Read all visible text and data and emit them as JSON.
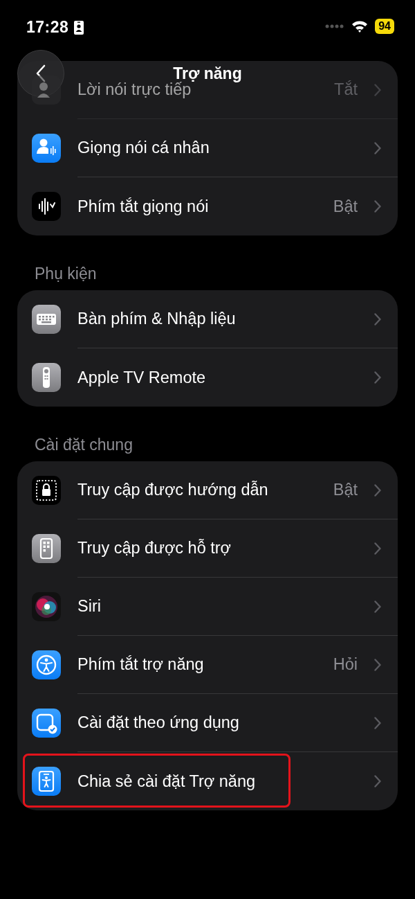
{
  "status_bar": {
    "time": "17:28",
    "battery": "94"
  },
  "nav": {
    "title": "Trợ năng"
  },
  "groups": [
    {
      "items": [
        {
          "label": "Lời nói trực tiếp",
          "value": "Tắt",
          "dimmed": true,
          "highlighted": false
        },
        {
          "label": "Giọng nói cá nhân",
          "dimmed": false,
          "highlighted": false
        },
        {
          "label": "Phím tắt giọng nói",
          "value": "Bật",
          "dimmed": false,
          "highlighted": false
        }
      ]
    },
    {
      "header": "Phụ kiện",
      "items": [
        {
          "label": "Bàn phím & Nhập liệu",
          "dimmed": false,
          "highlighted": false
        },
        {
          "label": "Apple TV Remote",
          "dimmed": false,
          "highlighted": false
        }
      ]
    },
    {
      "header": "Cài đặt chung",
      "items": [
        {
          "label": "Truy cập được hướng dẫn",
          "value": "Bật",
          "dimmed": false,
          "highlighted": false
        },
        {
          "label": "Truy cập được hỗ trợ",
          "dimmed": false,
          "highlighted": false
        },
        {
          "label": "Siri",
          "dimmed": false,
          "highlighted": false
        },
        {
          "label": "Phím tắt trợ năng",
          "value": "Hỏi",
          "dimmed": false,
          "highlighted": false
        },
        {
          "label": "Cài đặt theo ứng dụng",
          "dimmed": false,
          "highlighted": false
        },
        {
          "label": "Chia sẻ cài đặt Trợ năng",
          "dimmed": false,
          "highlighted": true
        }
      ]
    }
  ]
}
